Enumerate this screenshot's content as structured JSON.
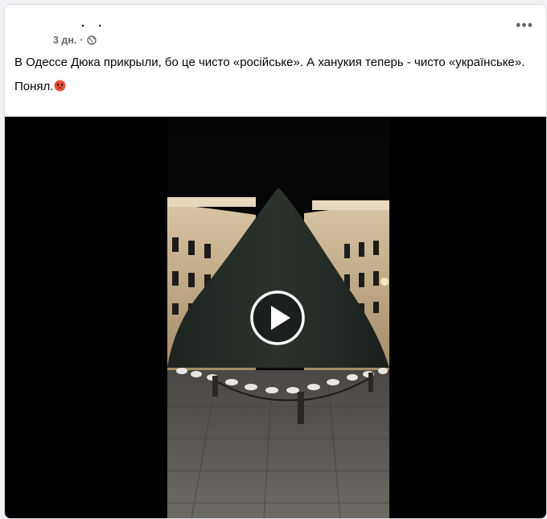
{
  "post": {
    "author": "· ·",
    "time": "3 дн.",
    "separator": "·",
    "privacy_icon": "globe-icon",
    "more_icon": "more-horizontal-icon",
    "more_label": "•••",
    "text_line_1": "В Одессе Дюка прикрыли, бо це чисто «російське». А ханукия теперь - чисто «українське».",
    "text_line_2": "Понял.",
    "emoji_icon": "angry-face-emoji"
  },
  "media": {
    "type": "video",
    "play_icon": "play-icon"
  },
  "colors": {
    "card_bg": "#ffffff",
    "page_bg": "#f0f2f5",
    "secondary_text": "#65676b",
    "emoji_color": "#e8553a"
  }
}
